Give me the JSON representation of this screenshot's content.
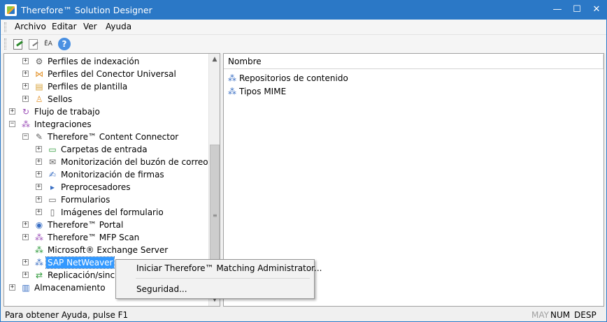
{
  "window": {
    "title": "Therefore™ Solution Designer",
    "minimize_glyph": "—",
    "maximize_glyph": "☐",
    "close_glyph": "✕",
    "accent_color": "#2b78c6"
  },
  "menu": {
    "items": [
      "Archivo",
      "Editar",
      "Ver",
      "Ayuda"
    ]
  },
  "toolbar": {
    "buttons": [
      "edit-icon",
      "disabled-edit-icon",
      "font-icon",
      "help-icon"
    ],
    "font_glyph": "ĒA",
    "help_glyph": "?"
  },
  "tree": {
    "expand_glyph": "+",
    "collapse_glyph": "−",
    "nodes": [
      {
        "label": "Perfiles de indexación",
        "icon": "index-profile-icon",
        "glyph": "⚙",
        "state": "collapsed"
      },
      {
        "label": "Perfiles del Conector Universal",
        "icon": "universal-connector-icon",
        "glyph": "⋈",
        "state": "collapsed"
      },
      {
        "label": "Perfiles de plantilla",
        "icon": "template-profile-icon",
        "glyph": "▤",
        "state": "collapsed"
      },
      {
        "label": "Sellos",
        "icon": "stamp-icon",
        "glyph": "♙",
        "state": "collapsed"
      },
      {
        "label": "Flujo de trabajo",
        "icon": "workflow-icon",
        "glyph": "↻",
        "state": "collapsed"
      },
      {
        "label": "Integraciones",
        "icon": "integrations-icon",
        "glyph": "⁂",
        "state": "expanded"
      },
      {
        "label": "Therefore™ Content Connector",
        "icon": "content-connector-icon",
        "glyph": "✎",
        "state": "expanded"
      },
      {
        "label": "Carpetas de entrada",
        "icon": "input-folder-icon",
        "glyph": "▭",
        "state": "collapsed"
      },
      {
        "label": "Monitorización del buzón de correo",
        "icon": "mailbox-monitor-icon",
        "glyph": "✉",
        "state": "collapsed"
      },
      {
        "label": "Monitorización de firmas",
        "icon": "signature-monitor-icon",
        "glyph": "✍",
        "state": "collapsed"
      },
      {
        "label": "Preprocesadores",
        "icon": "preprocessor-icon",
        "glyph": "▸",
        "state": "collapsed"
      },
      {
        "label": "Formularios",
        "icon": "form-icon",
        "glyph": "▭",
        "state": "collapsed"
      },
      {
        "label": "Imágenes del formulario",
        "icon": "form-image-icon",
        "glyph": "▯",
        "state": "collapsed"
      },
      {
        "label": "Therefore™ Portal",
        "icon": "portal-icon",
        "glyph": "◉",
        "state": "collapsed"
      },
      {
        "label": "Therefore™ MFP Scan",
        "icon": "mfp-scan-icon",
        "glyph": "⁂",
        "state": "collapsed"
      },
      {
        "label": "Microsoft® Exchange Server",
        "icon": "exchange-server-icon",
        "glyph": "⁂",
        "state": "leaf"
      },
      {
        "label": "SAP NetWeaver",
        "icon": "sap-netweaver-icon",
        "glyph": "⁂",
        "state": "collapsed",
        "selected": true
      },
      {
        "label": "Replicación/sincro",
        "icon": "replication-icon",
        "glyph": "⇄",
        "state": "collapsed"
      },
      {
        "label": "Almacenamiento",
        "icon": "storage-icon",
        "glyph": "▥",
        "state": "collapsed"
      }
    ]
  },
  "scrollbar": {
    "up_glyph": "▲",
    "down_glyph": "▼",
    "thumb_grip": "≡"
  },
  "list": {
    "column_header": "Nombre",
    "items": [
      {
        "label": "Repositorios de contenido",
        "icon": "content-repository-icon",
        "glyph": "⁂"
      },
      {
        "label": "Tipos MIME",
        "icon": "mime-type-icon",
        "glyph": "⁂"
      }
    ]
  },
  "context_menu": {
    "items": [
      "Iniciar Therefore™ Matching Administrator...",
      "Seguridad..."
    ]
  },
  "statusbar": {
    "text": "Para obtener Ayuda, pulse F1",
    "indicators": [
      {
        "label": "MAY",
        "active": false
      },
      {
        "label": "NUM",
        "active": true
      },
      {
        "label": "DESP",
        "active": true
      }
    ]
  }
}
